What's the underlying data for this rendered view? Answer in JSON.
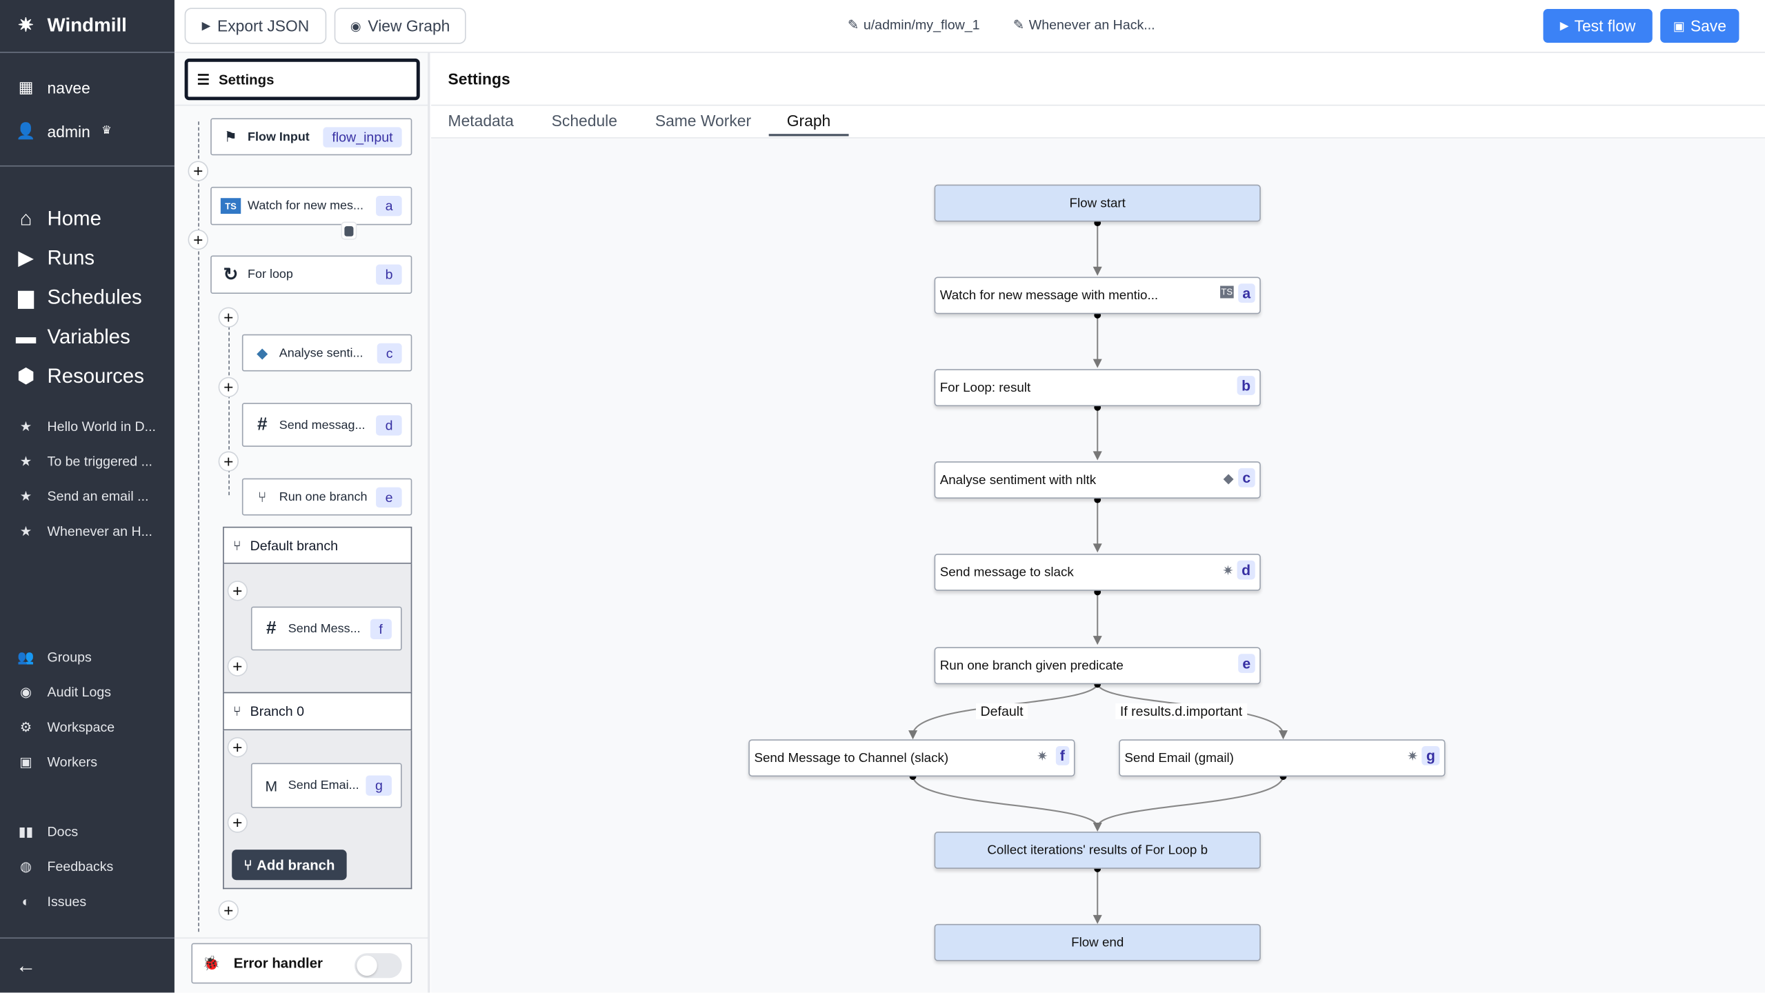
{
  "app": {
    "name": "Windmill"
  },
  "sidebar": {
    "workspace": "navee",
    "user": "admin",
    "main": [
      {
        "label": "Home",
        "icon": "home-icon"
      },
      {
        "label": "Runs",
        "icon": "play-icon"
      },
      {
        "label": "Schedules",
        "icon": "calendar-icon"
      },
      {
        "label": "Variables",
        "icon": "wallet-icon"
      },
      {
        "label": "Resources",
        "icon": "cubes-icon"
      }
    ],
    "favorites": [
      "Hello World in D...",
      "To be triggered ...",
      "Send an email ...",
      "Whenever an H..."
    ],
    "admin": [
      {
        "label": "Groups",
        "icon": "users-cog-icon"
      },
      {
        "label": "Audit Logs",
        "icon": "eye-icon"
      },
      {
        "label": "Workspace",
        "icon": "gear-icon"
      },
      {
        "label": "Workers",
        "icon": "robot-icon"
      }
    ],
    "help": [
      {
        "label": "Docs",
        "icon": "book-icon"
      },
      {
        "label": "Feedbacks",
        "icon": "discord-icon"
      },
      {
        "label": "Issues",
        "icon": "github-icon"
      }
    ]
  },
  "toolbar": {
    "export": "Export JSON",
    "view_graph": "View Graph",
    "path": "u/admin/my_flow_1",
    "summary": "Whenever an Hack...",
    "test": "Test flow",
    "save": "Save",
    "accent": "#3b82f6"
  },
  "left": {
    "settings": "Settings",
    "flow_input": {
      "label": "Flow Input",
      "badge": "flow_input"
    },
    "modules": [
      {
        "label": "Watch for new mes...",
        "id": "a",
        "icon": "typescript-icon"
      },
      {
        "label": "For loop",
        "id": "b",
        "icon": "loop-icon"
      },
      {
        "label": "Analyse senti...",
        "id": "c",
        "icon": "python-icon"
      },
      {
        "label": "Send messag...",
        "id": "d",
        "icon": "slack-icon"
      },
      {
        "label": "Run one branch",
        "id": "e",
        "icon": "branch-icon"
      },
      {
        "label": "Send Mess...",
        "id": "f",
        "icon": "slack-icon"
      },
      {
        "label": "Send Emai...",
        "id": "g",
        "icon": "gmail-icon"
      }
    ],
    "default_branch": "Default branch",
    "branch0": "Branch 0",
    "add_branch": "Add branch",
    "error_handler": "Error handler",
    "error_handler_enabled": false
  },
  "main": {
    "title": "Settings",
    "tabs": [
      {
        "label": "Metadata"
      },
      {
        "label": "Schedule"
      },
      {
        "label": "Same Worker"
      },
      {
        "label": "Graph",
        "active": true
      }
    ]
  },
  "graph": {
    "nodes": [
      {
        "label": "Flow start"
      },
      {
        "label": "Watch for new message with mentio...",
        "id": "a"
      },
      {
        "label": "For Loop: result",
        "id": "b"
      },
      {
        "label": "Analyse sentiment with nltk",
        "id": "c"
      },
      {
        "label": "Send message to slack",
        "id": "d"
      },
      {
        "label": "Run one branch given predicate",
        "id": "e"
      },
      {
        "label": "Send Message to Channel (slack)",
        "id": "f"
      },
      {
        "label": "Send Email (gmail)",
        "id": "g"
      },
      {
        "label": "Collect iterations' results of For Loop b"
      },
      {
        "label": "Flow end"
      }
    ],
    "edge_labels": [
      "Default",
      "If results.d.important"
    ]
  }
}
